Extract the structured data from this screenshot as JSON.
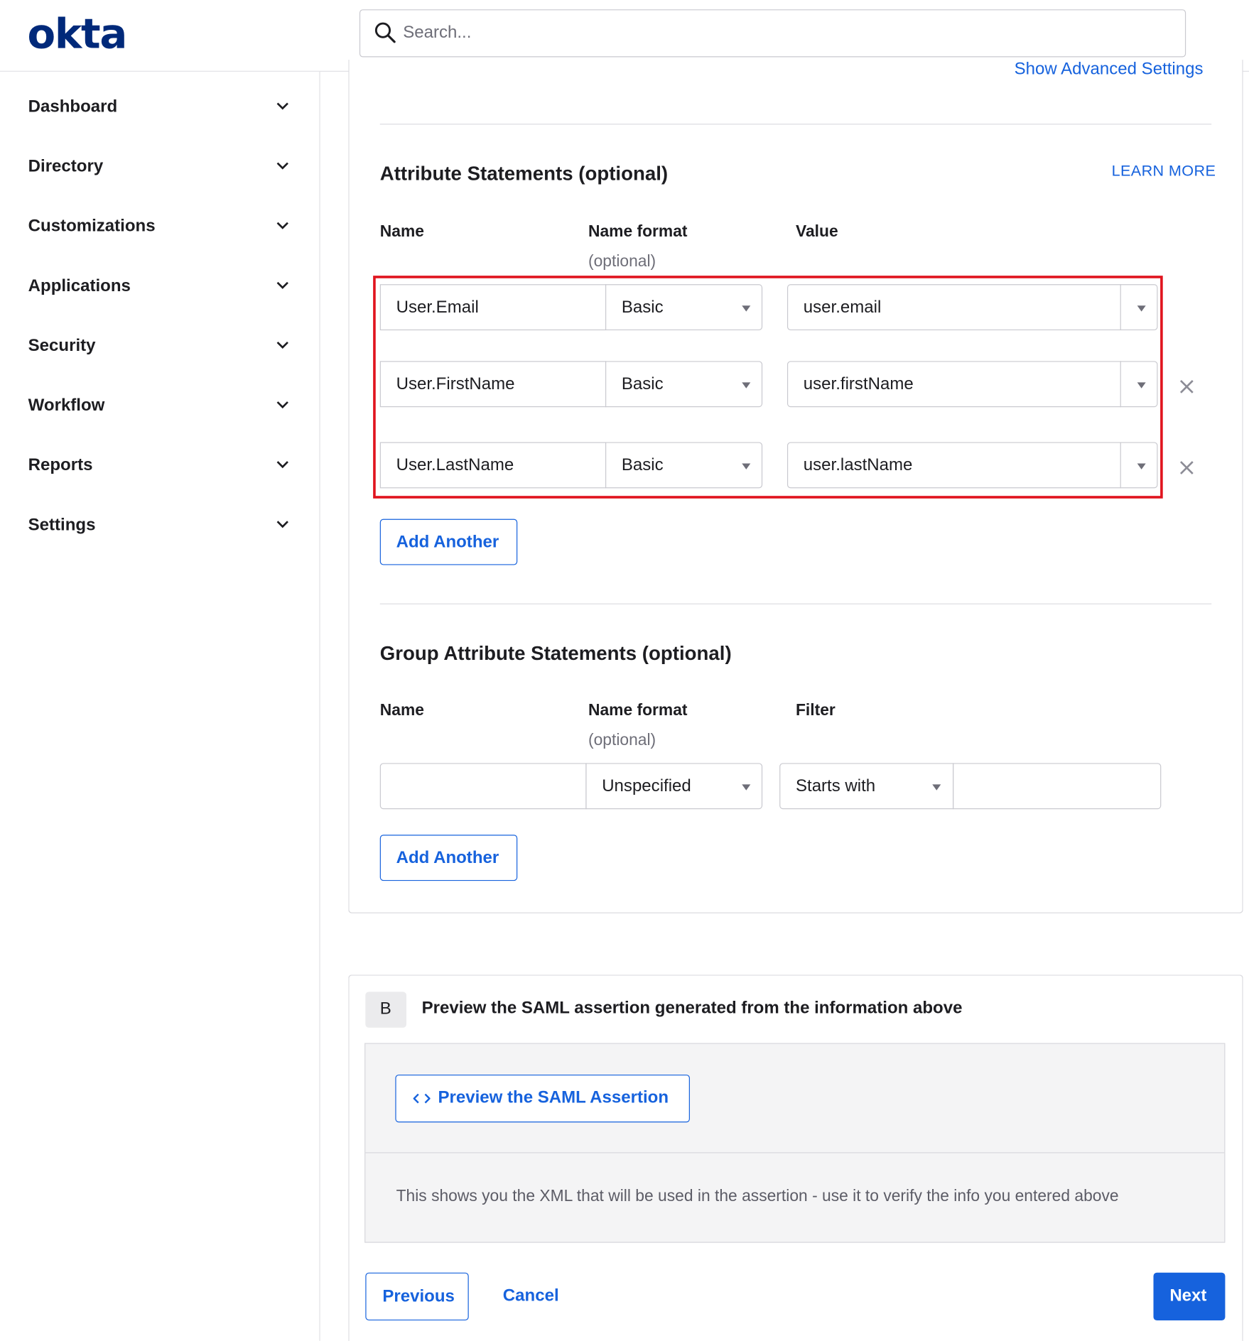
{
  "header": {
    "logo_text": "okta",
    "search_placeholder": "Search..."
  },
  "sidebar": {
    "items": [
      {
        "label": "Dashboard"
      },
      {
        "label": "Directory"
      },
      {
        "label": "Customizations"
      },
      {
        "label": "Applications"
      },
      {
        "label": "Security"
      },
      {
        "label": "Workflow"
      },
      {
        "label": "Reports"
      },
      {
        "label": "Settings"
      }
    ]
  },
  "main": {
    "advanced_settings_link": "Show Advanced Settings",
    "attribute_statements": {
      "title": "Attribute Statements (optional)",
      "learn_more": "LEARN MORE",
      "col_name": "Name",
      "col_name_format": "Name format",
      "col_name_format_sub": "(optional)",
      "col_value": "Value",
      "rows": [
        {
          "name": "User.Email",
          "format": "Basic",
          "value": "user.email"
        },
        {
          "name": "User.FirstName",
          "format": "Basic",
          "value": "user.firstName"
        },
        {
          "name": "User.LastName",
          "format": "Basic",
          "value": "user.lastName"
        }
      ],
      "add_another": "Add Another"
    },
    "group_attribute_statements": {
      "title": "Group Attribute Statements (optional)",
      "col_name": "Name",
      "col_name_format": "Name format",
      "col_name_format_sub": "(optional)",
      "col_filter": "Filter",
      "row": {
        "name": "",
        "format": "Unspecified",
        "filter_type": "Starts with",
        "filter_value": ""
      },
      "add_another": "Add Another"
    }
  },
  "section_b": {
    "step": "B",
    "title": "Preview the SAML assertion generated from the information above",
    "preview_button": "Preview the SAML Assertion",
    "help_text": "This shows you the XML that will be used in the assertion - use it to verify the info you entered above"
  },
  "footer": {
    "previous": "Previous",
    "cancel": "Cancel",
    "next": "Next"
  },
  "colors": {
    "brand": "#00297a",
    "accent": "#1662dd",
    "highlight": "#e0141e"
  }
}
